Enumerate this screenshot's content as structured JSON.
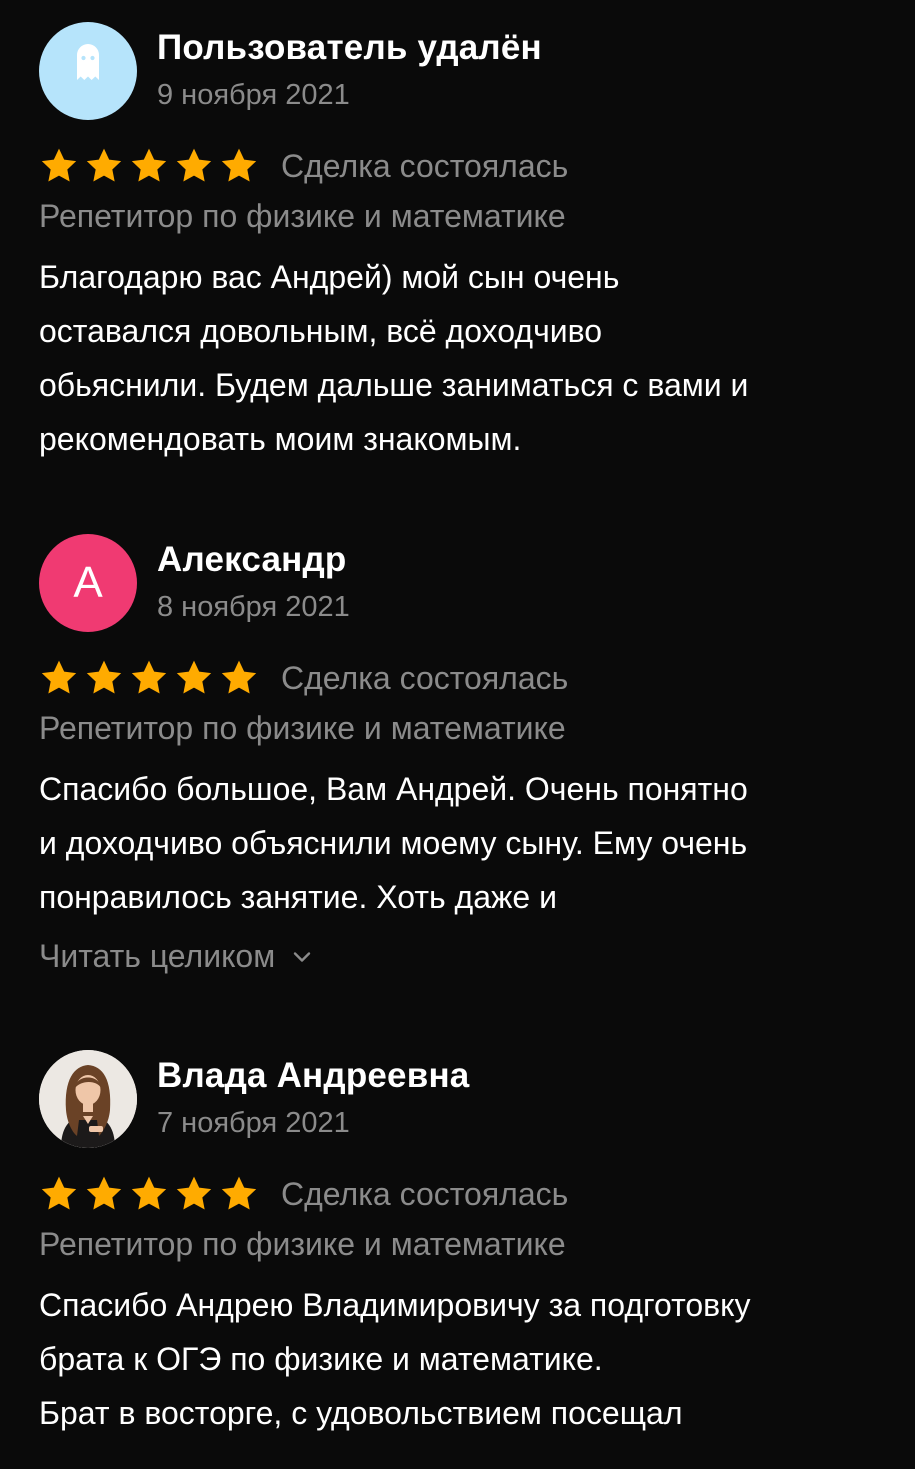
{
  "colors": {
    "background": "#0a0a0a",
    "star": "#ffab00",
    "secondary_text": "#8b8b8b",
    "ghost_avatar_bg": "#b6e4fb",
    "letter_avatar_bg": "#f03a72"
  },
  "reviews": [
    {
      "avatar_type": "ghost-icon",
      "author": "Пользователь удалён",
      "date": "9 ноября 2021",
      "rating": 5,
      "deal_status": "Сделка состоялась",
      "service": "Репетитор по физике и математике",
      "text": "Благодарю вас Андрей) мой сын очень\nоставался довольным, всё доходчиво\nобьяснили. Будем дальше заниматься с вами и\nрекомендовать моим знакомым."
    },
    {
      "avatar_type": "letter",
      "avatar_letter": "А",
      "author": "Александр",
      "date": "8 ноября 2021",
      "rating": 5,
      "deal_status": "Сделка состоялась",
      "service": "Репетитор по физике и математике",
      "text": "Спасибо большое, Вам Андрей. Очень понятно\nи доходчиво объяснили моему сыну. Ему очень\nпонравилось занятие. Хоть даже и",
      "read_more": "Читать целиком"
    },
    {
      "avatar_type": "photo",
      "author": "Влада Андреевна",
      "date": "7 ноября 2021",
      "rating": 5,
      "deal_status": "Сделка состоялась",
      "service": "Репетитор по физике и математике",
      "text": "Спасибо Андрею Владимировичу за подготовку\nбрата к ОГЭ по физике и математике.\nБрат в восторге, с удовольствием посещал"
    }
  ]
}
